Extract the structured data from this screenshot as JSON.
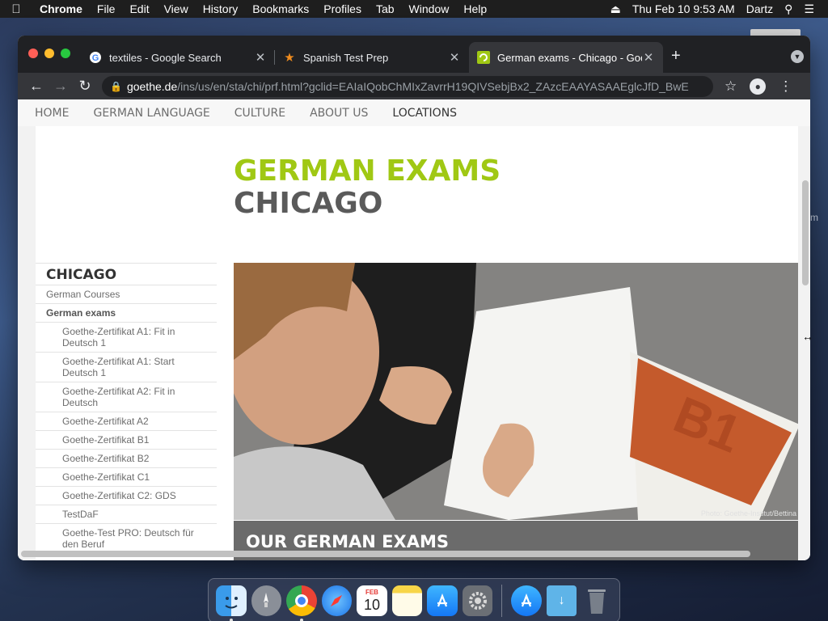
{
  "menubar": {
    "app": "Chrome",
    "items": [
      "File",
      "Edit",
      "View",
      "History",
      "Bookmarks",
      "Profiles",
      "Tab",
      "Window",
      "Help"
    ],
    "clock": "Thu Feb 10  9:53 AM",
    "user": "Dartz"
  },
  "browser": {
    "tabs": [
      {
        "title": "textiles - Google Search"
      },
      {
        "title": "Spanish Test Prep"
      },
      {
        "title": "German exams - Chicago - Goethe"
      }
    ],
    "url_host": "goethe.de",
    "url_path": "/ins/us/en/sta/chi/prf.html?gclid=EAIaIQobChMIxZavrrH19QIVSebjBx2_ZAzcEAAYASAAEglcJfD_BwE"
  },
  "site": {
    "nav": [
      "HOME",
      "GERMAN LANGUAGE",
      "CULTURE",
      "ABOUT US",
      "LOCATIONS"
    ],
    "hero_line1": "GERMAN EXAMS",
    "hero_line2": "CHICAGO",
    "sidebar": {
      "heading": "CHICAGO",
      "items": [
        {
          "label": "German Courses"
        },
        {
          "label": "German exams"
        }
      ],
      "subitems": [
        {
          "label": "Goethe-Zertifikat A1: Fit in Deutsch 1"
        },
        {
          "label": "Goethe-Zertifikat A1: Start Deutsch 1"
        },
        {
          "label": "Goethe-Zertifikat A2: Fit in Deutsch"
        },
        {
          "label": "Goethe-Zertifikat A2"
        },
        {
          "label": "Goethe-Zertifikat B1"
        },
        {
          "label": "Goethe-Zertifikat B2"
        },
        {
          "label": "Goethe-Zertifikat C1"
        },
        {
          "label": "Goethe-Zertifikat C2: GDS"
        },
        {
          "label": "TestDaF"
        },
        {
          "label": "Goethe-Test PRO: Deutsch für den Beruf"
        }
      ]
    },
    "photo_credit": "Photo: Goethe-Institut/Bettina",
    "book_text": "B1",
    "section_heading": "OUR GERMAN EXAMS"
  },
  "dock": {
    "calendar_month": "FEB",
    "calendar_day": "10"
  },
  "colors": {
    "brand_green": "#a0c814",
    "title_gray": "#5a5a5a"
  }
}
